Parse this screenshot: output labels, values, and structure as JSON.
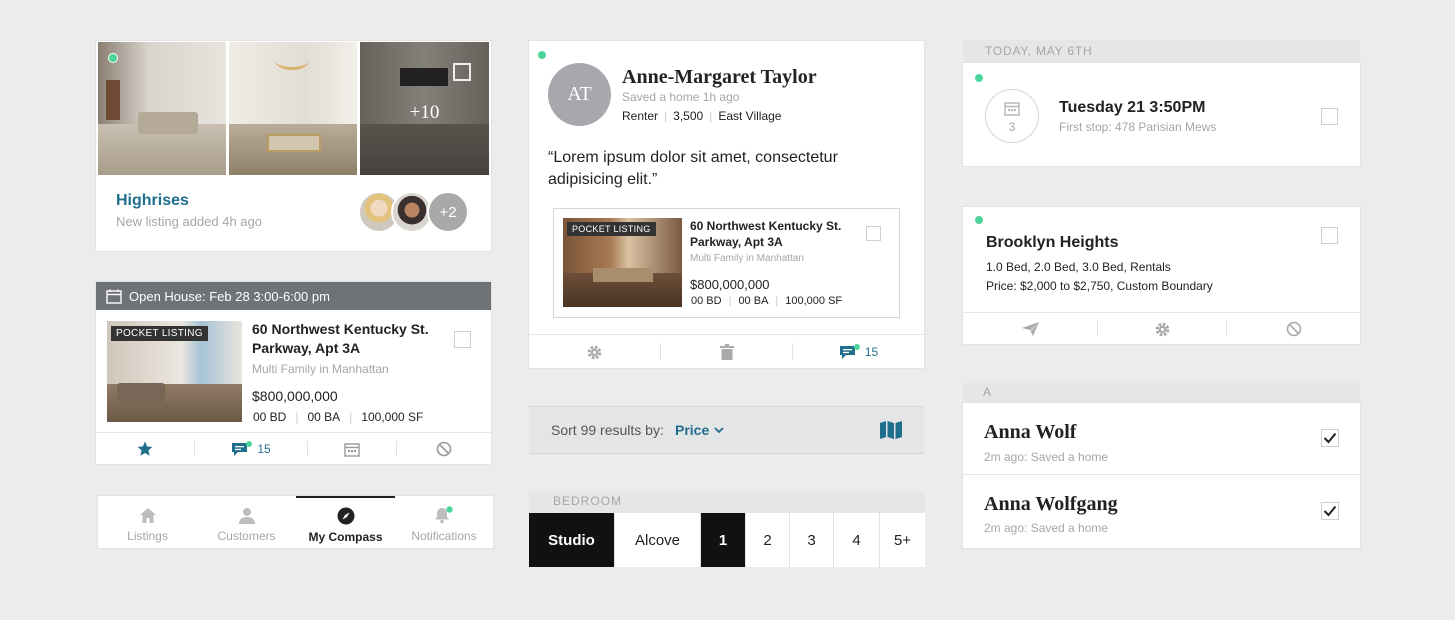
{
  "highrises": {
    "overlay_count": "+10",
    "title": "Highrises",
    "subtitle": "New listing added 4h ago",
    "avatars_more": "+2"
  },
  "open_house": {
    "header": "Open House:",
    "header_time": "Feb 28 3:00-6:00 pm",
    "badge": "POCKET LISTING",
    "address": "60 Northwest Kentucky St. Parkway, Apt 3A",
    "type": "Multi Family in Manhattan",
    "price": "$800,000,000",
    "bd": "00 BD",
    "ba": "00 BA",
    "sf": "100,000 SF",
    "comment_count": "15"
  },
  "tabbar": {
    "tabs": [
      {
        "label": "Listings"
      },
      {
        "label": "Customers"
      },
      {
        "label": "My Compass"
      },
      {
        "label": "Notifications"
      }
    ]
  },
  "customer": {
    "initials": "AT",
    "name": "Anne-Margaret Taylor",
    "activity": "Saved a home 1h ago",
    "role": "Renter",
    "budget": "3,500",
    "area": "East Village",
    "quote": "“Lorem ipsum dolor sit amet, consectetur adipisicing elit.”",
    "listing": {
      "badge": "POCKET LISTING",
      "address": "60 Northwest Kentucky St. Parkway, Apt 3A",
      "type": "Multi Family in Manhattan",
      "price": "$800,000,000",
      "bd": "00 BD",
      "ba": "00 BA",
      "sf": "100,000 SF"
    },
    "comment_count": "15"
  },
  "sort": {
    "label": "Sort 99 results by:",
    "value": "Price"
  },
  "bedroom": {
    "header": "BEDROOM",
    "options": [
      "Studio",
      "Alcove",
      "1",
      "2",
      "3",
      "4",
      "5+"
    ]
  },
  "today": {
    "header": "TODAY, MAY 6TH",
    "cal_number": "3",
    "title": "Tuesday 21 3:50PM",
    "subtitle": "First stop: 478 Parisian Mews"
  },
  "search": {
    "title": "Brooklyn Heights",
    "line1": "1.0 Bed, 2.0 Bed, 3.0 Bed, Rentals",
    "line2": "Price: $2,000 to $2,750,  Custom Boundary"
  },
  "contacts": {
    "header": "A",
    "items": [
      {
        "name": "Anna Wolf",
        "sub": "2m ago: Saved a home"
      },
      {
        "name": "Anna Wolfgang",
        "sub": "2m ago: Saved a home"
      }
    ]
  },
  "colors": {
    "accent": "#1f6e8c",
    "online": "#4cd49a",
    "header_gray": "#6f7276"
  }
}
